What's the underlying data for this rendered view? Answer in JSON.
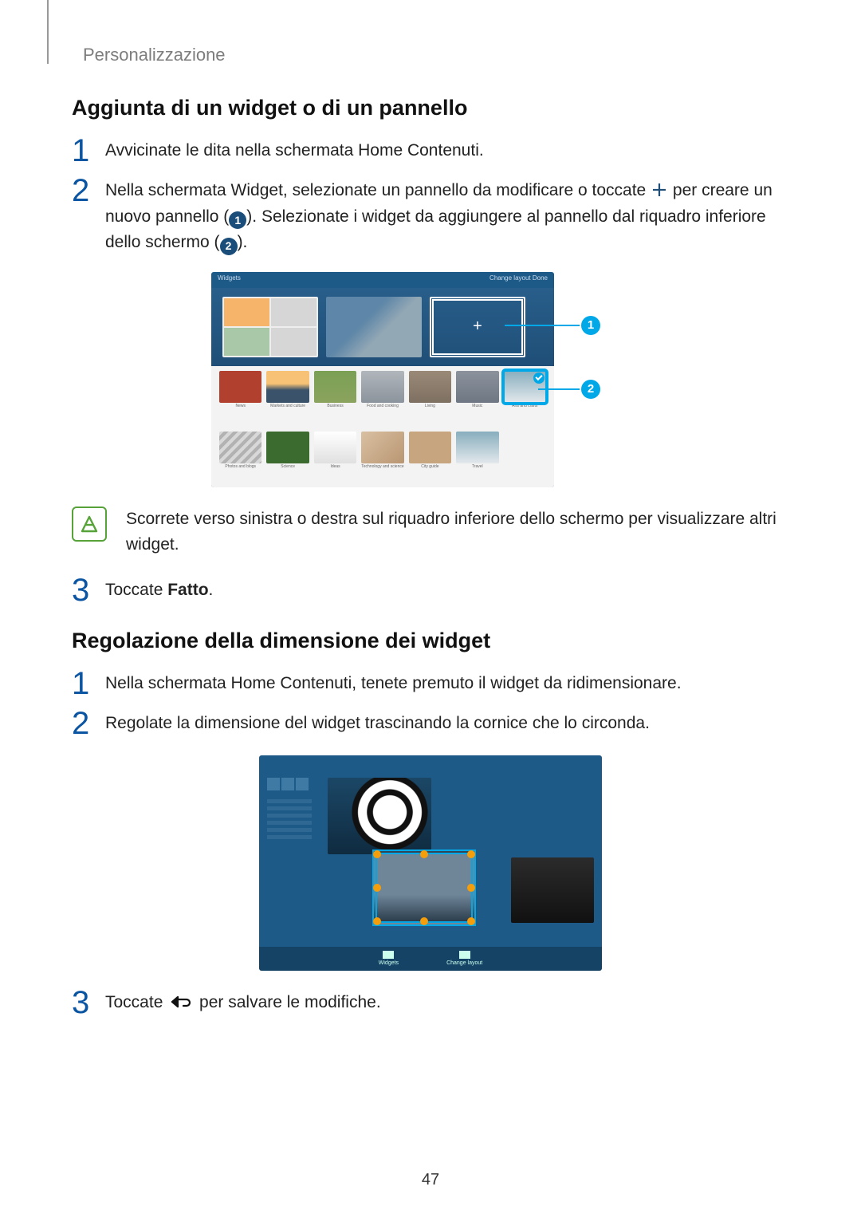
{
  "breadcrumb": "Personalizzazione",
  "section1": {
    "heading": "Aggiunta di un widget o di un pannello",
    "step1": "Avvicinate le dita nella schermata Home Contenuti.",
    "step2_a": "Nella schermata Widget, selezionate un pannello da modificare o toccate ",
    "step2_b": " per creare un nuovo pannello (",
    "step2_c": "). Selezionate i widget da aggiungere al pannello dal riquadro inferiore dello schermo (",
    "step2_d": ").",
    "callout1": "1",
    "callout2": "2",
    "note": "Scorrete verso sinistra o destra sul riquadro inferiore dello schermo per visualizzare altri widget.",
    "step3_a": "Toccate ",
    "step3_b": "Fatto",
    "step3_c": "."
  },
  "section2": {
    "heading": "Regolazione della dimensione dei widget",
    "step1": "Nella schermata Home Contenuti, tenete premuto il widget da ridimensionare.",
    "step2": "Regolate la dimensione del widget trascinando la cornice che lo circonda.",
    "step3_a": "Toccate ",
    "step3_b": " per salvare le modifiche."
  },
  "fig1": {
    "topbar_left": "Widgets",
    "topbar_right": "Change layout    Done",
    "tray_labels": [
      "News",
      "Markets and culture",
      "Business",
      "Food and cooking",
      "Living",
      "Music",
      "Arts and crafts",
      "Photos and blogs",
      "Science",
      "Ideas",
      "Technology and science",
      "City guide",
      "Travel"
    ]
  },
  "fig2": {
    "bottom_left": "Widgets",
    "bottom_right": "Change layout"
  },
  "page_number": "47"
}
